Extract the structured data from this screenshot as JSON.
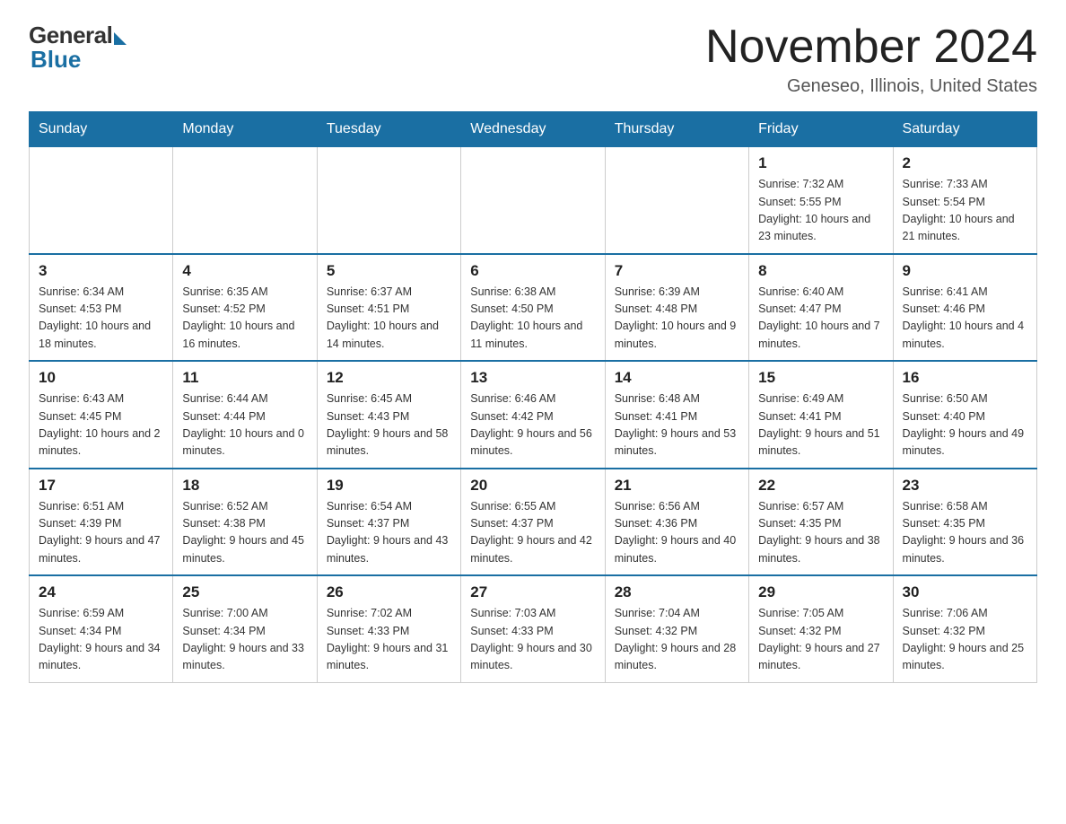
{
  "logo": {
    "general": "General",
    "blue": "Blue"
  },
  "title": "November 2024",
  "location": "Geneseo, Illinois, United States",
  "weekdays": [
    "Sunday",
    "Monday",
    "Tuesday",
    "Wednesday",
    "Thursday",
    "Friday",
    "Saturday"
  ],
  "weeks": [
    [
      {
        "day": "",
        "info": ""
      },
      {
        "day": "",
        "info": ""
      },
      {
        "day": "",
        "info": ""
      },
      {
        "day": "",
        "info": ""
      },
      {
        "day": "",
        "info": ""
      },
      {
        "day": "1",
        "info": "Sunrise: 7:32 AM\nSunset: 5:55 PM\nDaylight: 10 hours and 23 minutes."
      },
      {
        "day": "2",
        "info": "Sunrise: 7:33 AM\nSunset: 5:54 PM\nDaylight: 10 hours and 21 minutes."
      }
    ],
    [
      {
        "day": "3",
        "info": "Sunrise: 6:34 AM\nSunset: 4:53 PM\nDaylight: 10 hours and 18 minutes."
      },
      {
        "day": "4",
        "info": "Sunrise: 6:35 AM\nSunset: 4:52 PM\nDaylight: 10 hours and 16 minutes."
      },
      {
        "day": "5",
        "info": "Sunrise: 6:37 AM\nSunset: 4:51 PM\nDaylight: 10 hours and 14 minutes."
      },
      {
        "day": "6",
        "info": "Sunrise: 6:38 AM\nSunset: 4:50 PM\nDaylight: 10 hours and 11 minutes."
      },
      {
        "day": "7",
        "info": "Sunrise: 6:39 AM\nSunset: 4:48 PM\nDaylight: 10 hours and 9 minutes."
      },
      {
        "day": "8",
        "info": "Sunrise: 6:40 AM\nSunset: 4:47 PM\nDaylight: 10 hours and 7 minutes."
      },
      {
        "day": "9",
        "info": "Sunrise: 6:41 AM\nSunset: 4:46 PM\nDaylight: 10 hours and 4 minutes."
      }
    ],
    [
      {
        "day": "10",
        "info": "Sunrise: 6:43 AM\nSunset: 4:45 PM\nDaylight: 10 hours and 2 minutes."
      },
      {
        "day": "11",
        "info": "Sunrise: 6:44 AM\nSunset: 4:44 PM\nDaylight: 10 hours and 0 minutes."
      },
      {
        "day": "12",
        "info": "Sunrise: 6:45 AM\nSunset: 4:43 PM\nDaylight: 9 hours and 58 minutes."
      },
      {
        "day": "13",
        "info": "Sunrise: 6:46 AM\nSunset: 4:42 PM\nDaylight: 9 hours and 56 minutes."
      },
      {
        "day": "14",
        "info": "Sunrise: 6:48 AM\nSunset: 4:41 PM\nDaylight: 9 hours and 53 minutes."
      },
      {
        "day": "15",
        "info": "Sunrise: 6:49 AM\nSunset: 4:41 PM\nDaylight: 9 hours and 51 minutes."
      },
      {
        "day": "16",
        "info": "Sunrise: 6:50 AM\nSunset: 4:40 PM\nDaylight: 9 hours and 49 minutes."
      }
    ],
    [
      {
        "day": "17",
        "info": "Sunrise: 6:51 AM\nSunset: 4:39 PM\nDaylight: 9 hours and 47 minutes."
      },
      {
        "day": "18",
        "info": "Sunrise: 6:52 AM\nSunset: 4:38 PM\nDaylight: 9 hours and 45 minutes."
      },
      {
        "day": "19",
        "info": "Sunrise: 6:54 AM\nSunset: 4:37 PM\nDaylight: 9 hours and 43 minutes."
      },
      {
        "day": "20",
        "info": "Sunrise: 6:55 AM\nSunset: 4:37 PM\nDaylight: 9 hours and 42 minutes."
      },
      {
        "day": "21",
        "info": "Sunrise: 6:56 AM\nSunset: 4:36 PM\nDaylight: 9 hours and 40 minutes."
      },
      {
        "day": "22",
        "info": "Sunrise: 6:57 AM\nSunset: 4:35 PM\nDaylight: 9 hours and 38 minutes."
      },
      {
        "day": "23",
        "info": "Sunrise: 6:58 AM\nSunset: 4:35 PM\nDaylight: 9 hours and 36 minutes."
      }
    ],
    [
      {
        "day": "24",
        "info": "Sunrise: 6:59 AM\nSunset: 4:34 PM\nDaylight: 9 hours and 34 minutes."
      },
      {
        "day": "25",
        "info": "Sunrise: 7:00 AM\nSunset: 4:34 PM\nDaylight: 9 hours and 33 minutes."
      },
      {
        "day": "26",
        "info": "Sunrise: 7:02 AM\nSunset: 4:33 PM\nDaylight: 9 hours and 31 minutes."
      },
      {
        "day": "27",
        "info": "Sunrise: 7:03 AM\nSunset: 4:33 PM\nDaylight: 9 hours and 30 minutes."
      },
      {
        "day": "28",
        "info": "Sunrise: 7:04 AM\nSunset: 4:32 PM\nDaylight: 9 hours and 28 minutes."
      },
      {
        "day": "29",
        "info": "Sunrise: 7:05 AM\nSunset: 4:32 PM\nDaylight: 9 hours and 27 minutes."
      },
      {
        "day": "30",
        "info": "Sunrise: 7:06 AM\nSunset: 4:32 PM\nDaylight: 9 hours and 25 minutes."
      }
    ]
  ]
}
